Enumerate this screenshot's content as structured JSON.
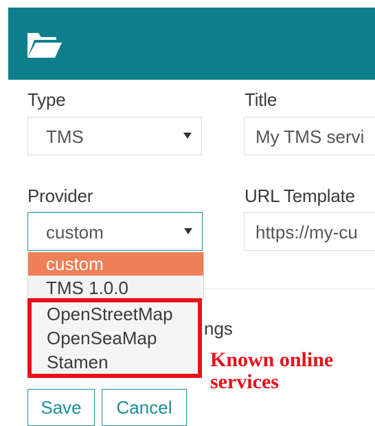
{
  "header": {
    "bg_color": "#0f7e8c",
    "icon": "folder-open-icon"
  },
  "form": {
    "type_label": "Type",
    "type_value": "TMS",
    "title_label": "Title",
    "title_value": "My TMS servi",
    "provider_label": "Provider",
    "provider_value": "custom",
    "url_label": "URL Template",
    "url_value": "https://my-cu"
  },
  "provider_dropdown": {
    "options": [
      "custom",
      "TMS 1.0.0",
      "OpenStreetMap",
      "OpenSeaMap",
      "Stamen"
    ],
    "selected": "custom"
  },
  "panel_fragment": {
    "title": "ngs"
  },
  "annotation": {
    "line1": "Known online",
    "line2": "services",
    "color": "#e8101a"
  },
  "buttons": {
    "save": "Save",
    "cancel": "Cancel"
  }
}
